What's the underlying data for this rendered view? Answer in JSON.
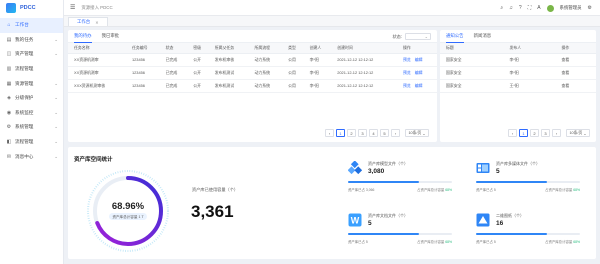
{
  "app": {
    "brand": "PDCC"
  },
  "header": {
    "breadcrumb": "资源接入 PDCC",
    "user": "系统管理员"
  },
  "tabbar": {
    "tabs": [
      "工作台"
    ]
  },
  "sidebar": {
    "items": [
      {
        "label": "工作台",
        "icon": "home-icon",
        "active": true
      },
      {
        "label": "我的任务",
        "icon": "clipboard-icon"
      },
      {
        "label": "资产管理",
        "icon": "database-icon"
      },
      {
        "label": "流程管理",
        "icon": "document-icon"
      },
      {
        "label": "资源管理",
        "icon": "grid-icon"
      },
      {
        "label": "分级保护",
        "icon": "shield-icon"
      },
      {
        "label": "系统监控",
        "icon": "monitor-icon"
      },
      {
        "label": "系统管理",
        "icon": "settings-icon"
      },
      {
        "label": "流程管理",
        "icon": "flow-icon"
      },
      {
        "label": "消息中心",
        "icon": "message-icon"
      }
    ]
  },
  "todo": {
    "tabs": [
      "我的待办",
      "我已审批"
    ],
    "filter_label": "状态:",
    "columns": [
      "任务名称",
      "任务编号",
      "状态",
      "密级",
      "所属父任务",
      "所属流程",
      "类型",
      "创建人",
      "创建时间",
      "操作"
    ],
    "rows": [
      [
        "XX资源机测审",
        "123456",
        "已完成",
        "公开",
        "发布机审核",
        "动力系统",
        "公用",
        "李*阳",
        "2021-12-12 12:12:12"
      ],
      [
        "XX资源机测审",
        "123456",
        "已完成",
        "公开",
        "发布机测试",
        "动力系统",
        "公用",
        "李*阳",
        "2021-12-12 12:12:12"
      ],
      [
        "XXX资源机测审核",
        "123456",
        "已完成",
        "公开",
        "发布机测试",
        "动力系统",
        "公用",
        "李*阳",
        "2021-12-12 12:12:12"
      ]
    ],
    "actions": [
      "预览",
      "编辑"
    ],
    "pages": [
      "1",
      "2",
      "3",
      "4",
      "5"
    ],
    "page_size": "10条/页"
  },
  "notice": {
    "tabs": [
      "通知公告",
      "新闻消息"
    ],
    "columns": [
      "标题",
      "发布人",
      "操作"
    ],
    "rows": [
      [
        "国家安全",
        "李*阳"
      ],
      [
        "国家安全",
        "李*阳"
      ],
      [
        "国家安全",
        "王*阳"
      ]
    ],
    "view_label": "查看",
    "pages": [
      "1",
      "2",
      "3"
    ],
    "page_size": "10条/页"
  },
  "stats": {
    "title": "资产库空间统计",
    "usage_percent_text": "68.96%",
    "usage_percent": 68.96,
    "usage_caption": "资产库总计容量 1 T",
    "total_label": "资产库已使用容量（个）",
    "total_value": "3,361",
    "share_label": "占资产库总计容量",
    "items": [
      {
        "label": "资产库模型文件（个）",
        "count": "3,080",
        "used": "资产库已占 3,066",
        "share": "68%",
        "fill": 0.68,
        "icon": "cube-cluster-icon"
      },
      {
        "label": "资产库多媒体文件（个）",
        "count": "5",
        "used": "资产库已占 5",
        "share": "68%",
        "fill": 0.68,
        "icon": "media-icon"
      },
      {
        "label": "资产库文档文件（个）",
        "count": "5",
        "used": "资产库已占 5",
        "share": "68%",
        "fill": 0.68,
        "icon": "word-document-icon"
      },
      {
        "label": "二维图纸（个）",
        "count": "16",
        "used": "资产库已占 5",
        "share": "68%",
        "fill": 0.68,
        "icon": "drawing-icon"
      }
    ]
  }
}
